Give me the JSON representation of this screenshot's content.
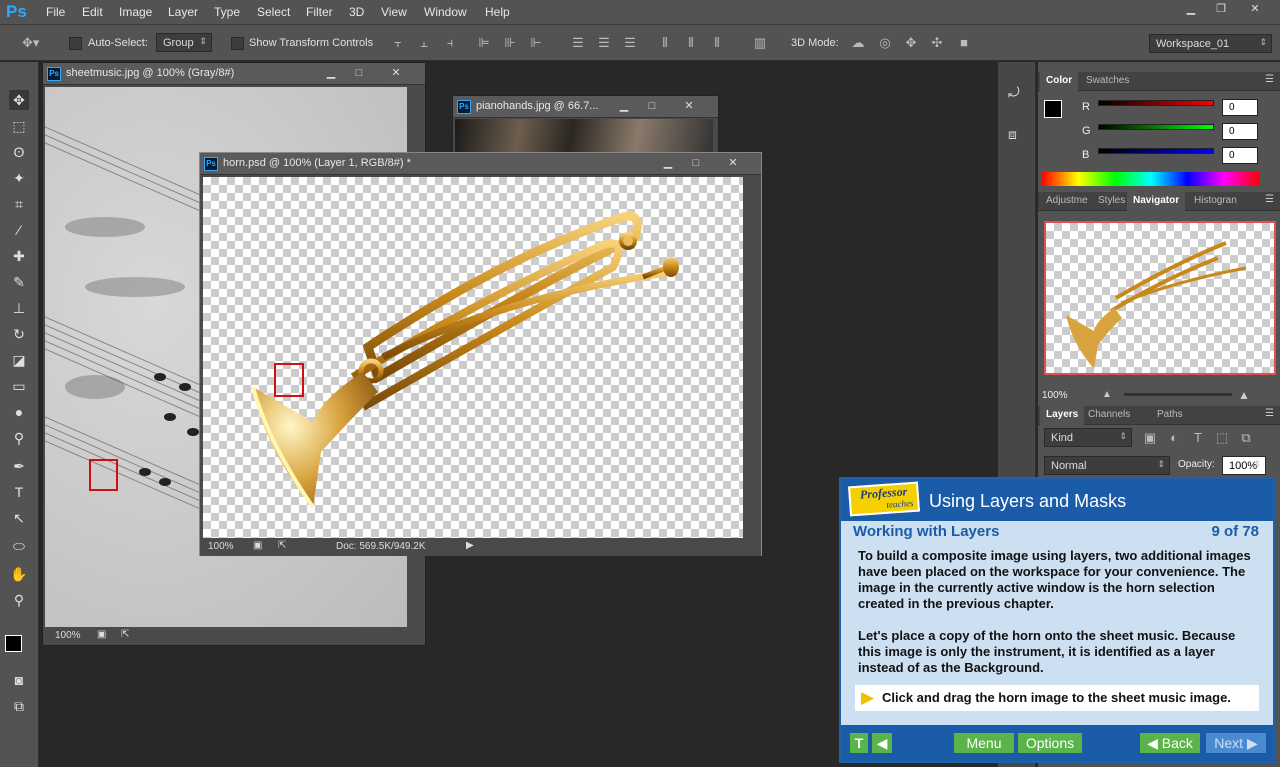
{
  "app": {
    "logo": "Ps"
  },
  "menu": [
    "File",
    "Edit",
    "Image",
    "Layer",
    "Type",
    "Select",
    "Filter",
    "3D",
    "View",
    "Window",
    "Help"
  ],
  "options": {
    "auto_select_label": "Auto-Select:",
    "auto_select_value": "Group",
    "show_transform_label": "Show Transform Controls",
    "mode_3d_label": "3D Mode:",
    "workspace": "Workspace_01"
  },
  "docs": {
    "sheet": {
      "title": "sheetmusic.jpg @ 100% (Gray/8#)",
      "zoom": "100%"
    },
    "piano": {
      "title": "pianohands.jpg @ 66.7..."
    },
    "horn": {
      "title": "horn.psd @ 100% (Layer 1, RGB/8#) *",
      "zoom": "100%",
      "doc": "Doc: 569.5K/949.2K"
    }
  },
  "color_panel": {
    "tabs": [
      "Color",
      "Swatches"
    ],
    "r_label": "R",
    "g_label": "G",
    "b_label": "B",
    "r": "0",
    "g": "0",
    "b": "0"
  },
  "nav_panel": {
    "tabs": [
      "Adjustme",
      "Styles",
      "Navigator",
      "Histogran"
    ],
    "zoom": "100%"
  },
  "layers_panel": {
    "tabs": [
      "Layers",
      "Channels",
      "Paths"
    ],
    "kind": "Kind",
    "blend": "Normal",
    "opacity_label": "Opacity:",
    "opacity": "100%"
  },
  "tutorial": {
    "logo_top": "Professor",
    "logo_bottom": "teaches",
    "title": "Using Layers and Masks",
    "section": "Working with Layers",
    "page": "9 of 78",
    "p1": "To build a composite image using layers, two additional images have been placed on the workspace for your convenience. The image in the currently active window is the horn selection created in the previous chapter.",
    "p2": "Let's place a copy of the horn onto the sheet music. Because this image is only the instrument, it is identified as a layer instead of as the Background.",
    "instruction": "Click and drag the horn image to the sheet music image.",
    "btn_t": "T",
    "btn_menu": "Menu",
    "btn_options": "Options",
    "btn_back": "◀ Back",
    "btn_next": "Next ▶"
  }
}
